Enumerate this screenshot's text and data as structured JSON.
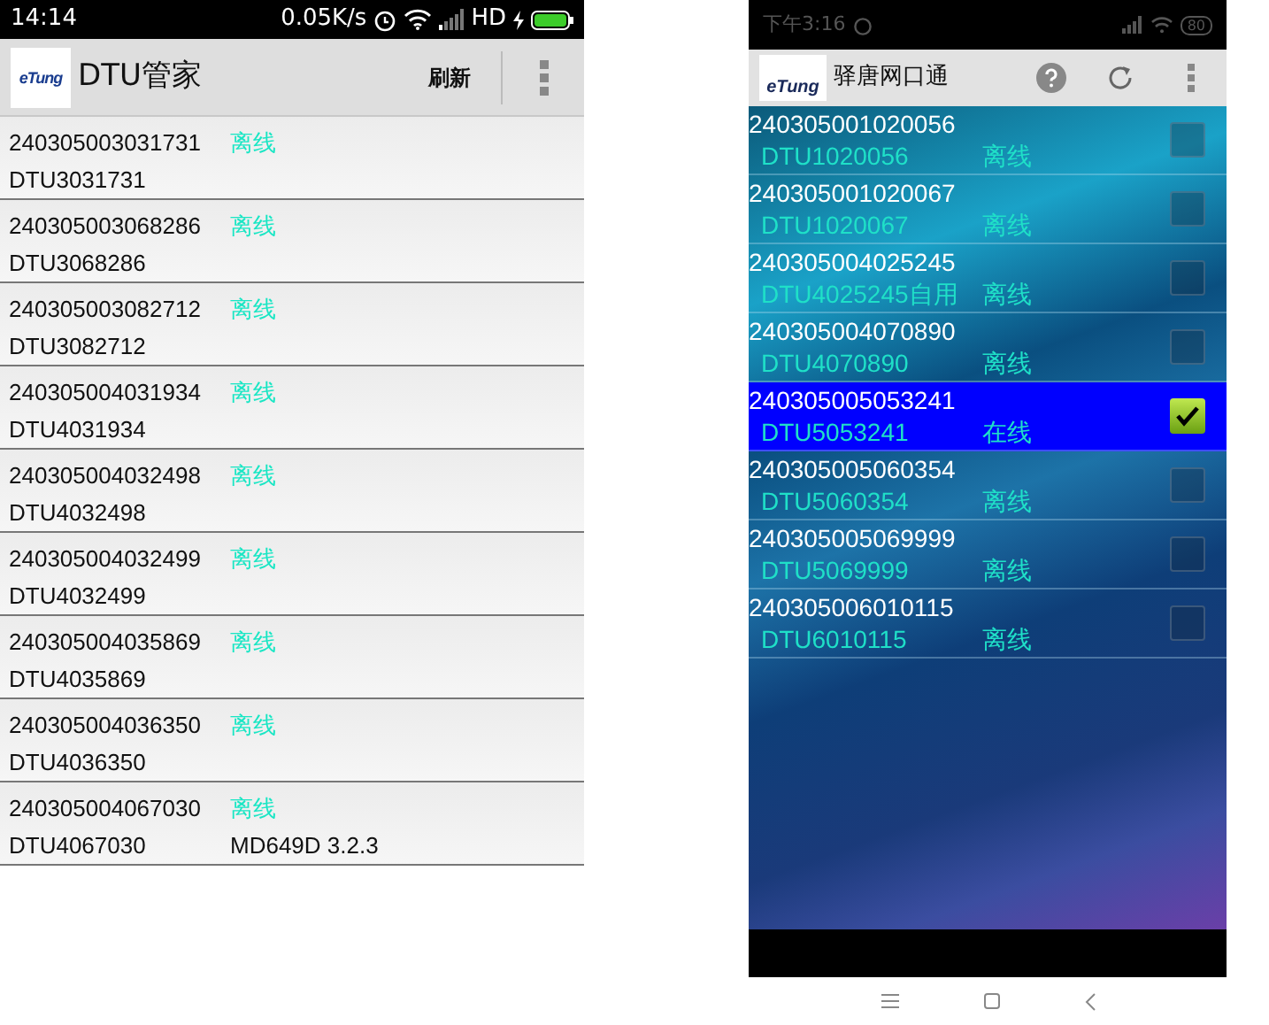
{
  "left_phone": {
    "status_bar": {
      "time": "14:14",
      "speed": "0.05K/s",
      "network": "HD"
    },
    "app_bar": {
      "logo": "eTung",
      "title": "DTU管家",
      "action": "刷新"
    },
    "devices": [
      {
        "id": "240305003031731",
        "status": "离线",
        "name": "DTU3031731"
      },
      {
        "id": "240305003068286",
        "status": "离线",
        "name": "DTU3068286"
      },
      {
        "id": "240305003082712",
        "status": "离线",
        "name": "DTU3082712"
      },
      {
        "id": "240305004031934",
        "status": "离线",
        "name": "DTU4031934"
      },
      {
        "id": "240305004032498",
        "status": "离线",
        "name": "DTU4032498"
      },
      {
        "id": "240305004032499",
        "status": "离线",
        "name": "DTU4032499"
      },
      {
        "id": "240305004035869",
        "status": "离线",
        "name": "DTU4035869"
      },
      {
        "id": "240305004036350",
        "status": "离线",
        "name": "DTU4036350"
      },
      {
        "id": "240305004067030",
        "status": "离线",
        "name": "DTU4067030",
        "version": "MD649D 3.2.3"
      }
    ]
  },
  "right_phone": {
    "status_bar": {
      "time": "下午3:16",
      "battery": "80"
    },
    "app_bar": {
      "logo": "eTung",
      "title": "驿唐网口通"
    },
    "devices": [
      {
        "id": "240305001020056",
        "name": "DTU1020056",
        "status": "离线",
        "selected": false,
        "checked": false
      },
      {
        "id": "240305001020067",
        "name": "DTU1020067",
        "status": "离线",
        "selected": false,
        "checked": false
      },
      {
        "id": "240305004025245",
        "name": "DTU4025245自用",
        "status": "离线",
        "selected": false,
        "checked": false
      },
      {
        "id": "240305004070890",
        "name": "DTU4070890",
        "status": "离线",
        "selected": false,
        "checked": false
      },
      {
        "id": "240305005053241",
        "name": "DTU5053241",
        "status": "在线",
        "selected": true,
        "checked": true
      },
      {
        "id": "240305005060354",
        "name": "DTU5060354",
        "status": "离线",
        "selected": false,
        "checked": false
      },
      {
        "id": "240305005069999",
        "name": "DTU5069999",
        "status": "离线",
        "selected": false,
        "checked": false
      },
      {
        "id": "240305006010115",
        "name": "DTU6010115",
        "status": "离线",
        "selected": false,
        "checked": false
      }
    ]
  }
}
